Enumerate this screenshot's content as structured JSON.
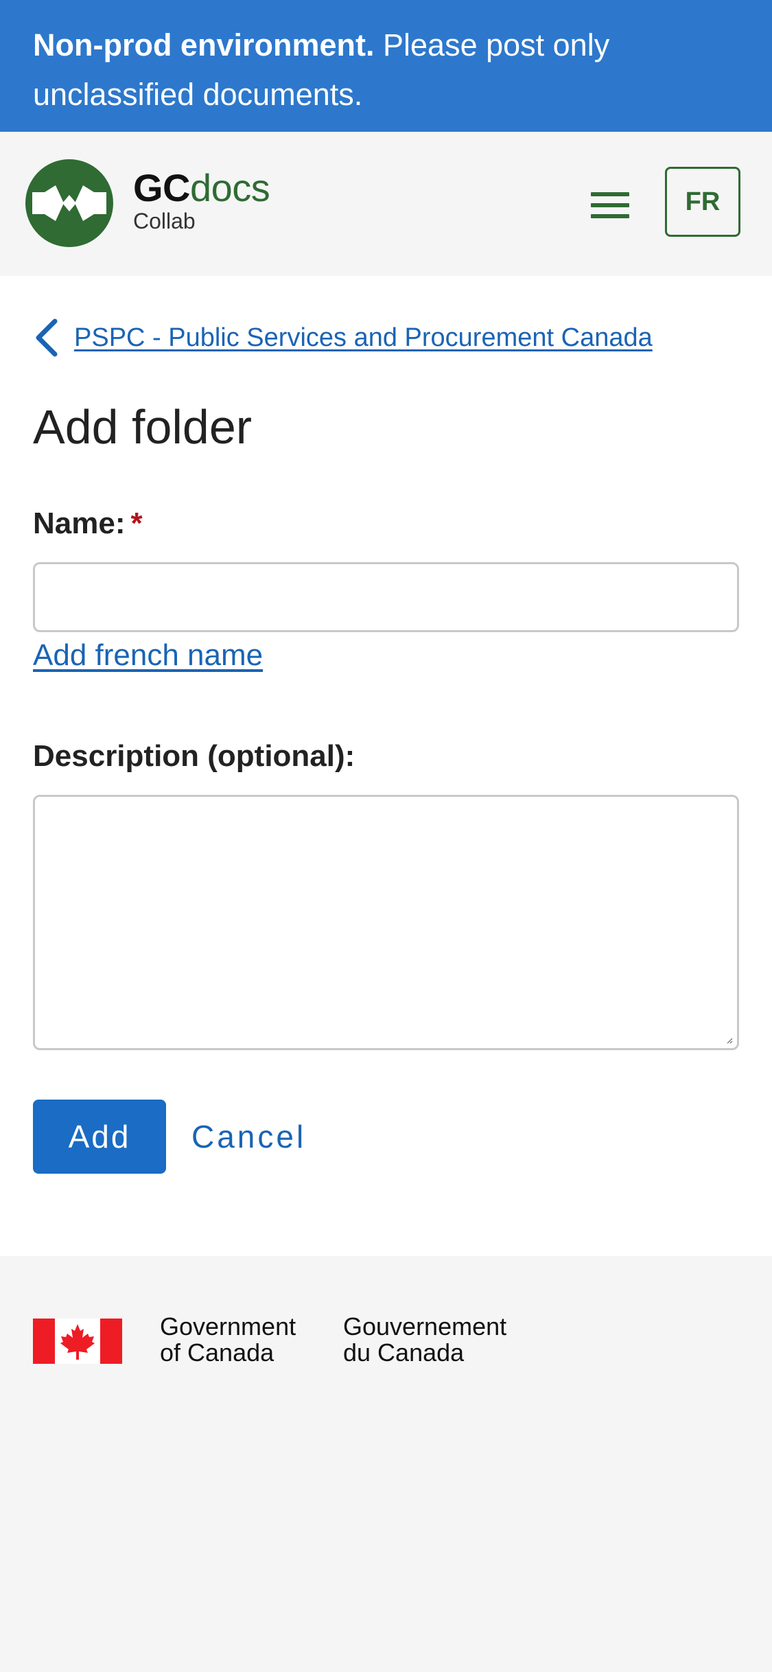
{
  "banner": {
    "bold": "Non-prod environment.",
    "text": "Please post only unclassified documents."
  },
  "header": {
    "brand_gc": "GC",
    "brand_docs": "docs",
    "brand_sub": "Collab",
    "lang_button": "FR"
  },
  "breadcrumb": {
    "link": "PSPC - Public Services and Procurement Canada"
  },
  "form": {
    "title": "Add folder",
    "name_label": "Name:",
    "required_mark": "*",
    "name_value": "",
    "add_french_name": "Add french name",
    "description_label": "Description (optional):",
    "description_value": "",
    "add_button": "Add",
    "cancel_button": "Cancel"
  },
  "footer": {
    "gov_en_line1": "Government",
    "gov_en_line2": "of Canada",
    "gov_fr_line1": "Gouvernement",
    "gov_fr_line2": "du Canada"
  },
  "colors": {
    "banner": "#2d78cc",
    "brand_green": "#2f6b33",
    "link": "#1a64b4",
    "primary_button": "#1a6cc4",
    "required": "#b4131b",
    "flag_red": "#ee1c25"
  },
  "icons": [
    "gcdocs-logo-icon",
    "menu-icon",
    "chevron-left-icon",
    "canada-flag-icon"
  ]
}
